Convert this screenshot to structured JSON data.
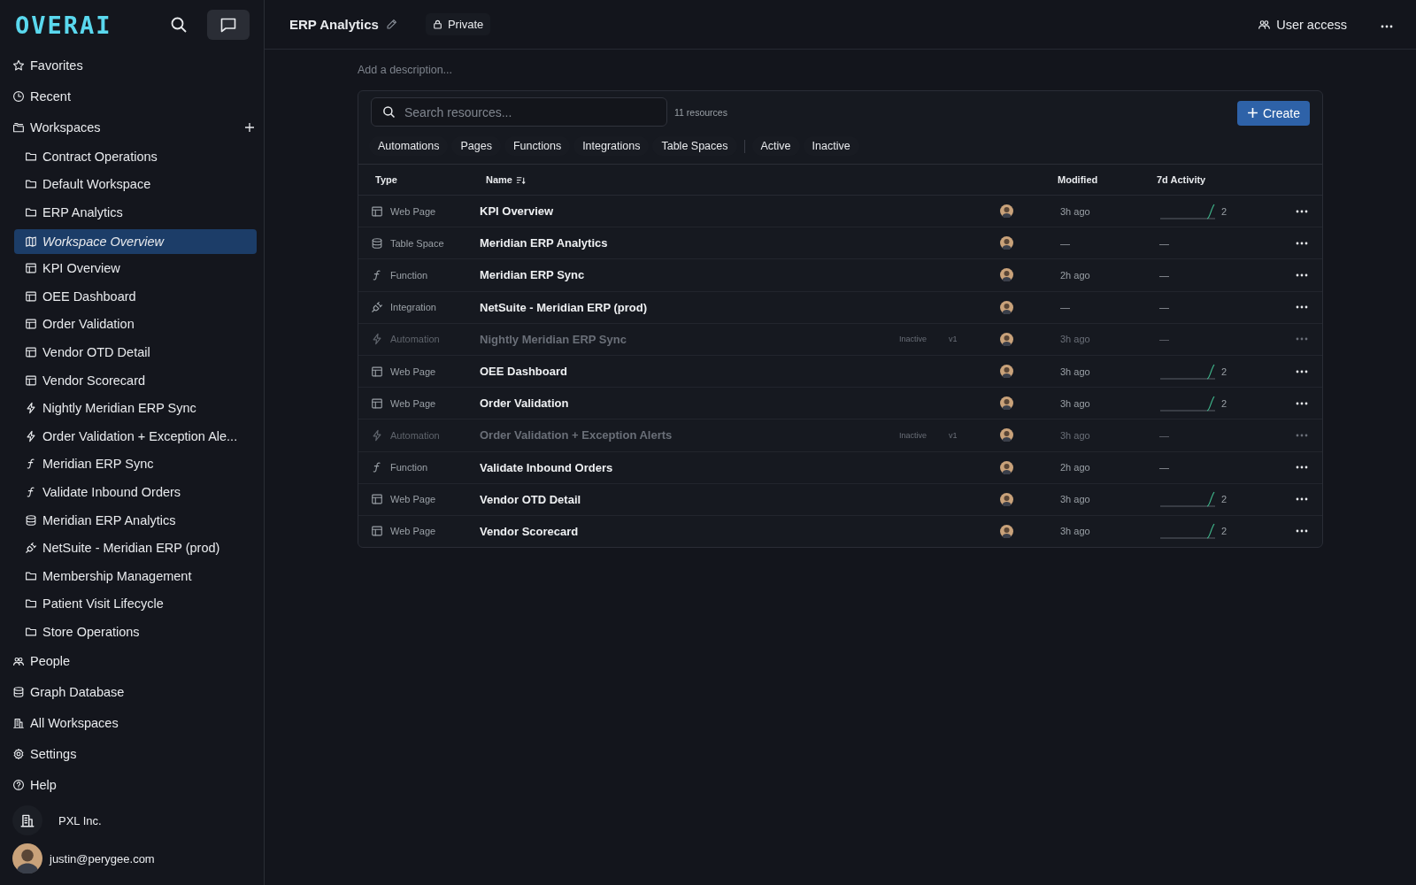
{
  "logo": "OVERAI",
  "sidebar": {
    "items": [
      {
        "kind": "star",
        "label": "Favorites",
        "selected": false
      },
      {
        "kind": "clock",
        "label": "Recent",
        "selected": false
      },
      {
        "kind": "folders",
        "label": "Workspaces",
        "selected": false,
        "addable": true,
        "children": [
          {
            "kind": "folder",
            "label": "Contract Operations",
            "selected": false
          },
          {
            "kind": "folder",
            "label": "Default Workspace",
            "selected": false
          },
          {
            "kind": "folder",
            "label": "ERP Analytics",
            "selected": false,
            "children": [
              {
                "kind": "map",
                "label": "Workspace Overview",
                "selected": true
              },
              {
                "kind": "page",
                "label": "KPI Overview",
                "selected": false
              },
              {
                "kind": "page",
                "label": "OEE Dashboard",
                "selected": false
              },
              {
                "kind": "page",
                "label": "Order Validation",
                "selected": false
              },
              {
                "kind": "page",
                "label": "Vendor OTD Detail",
                "selected": false
              },
              {
                "kind": "page",
                "label": "Vendor Scorecard",
                "selected": false
              },
              {
                "kind": "automation",
                "label": "Nightly Meridian ERP Sync",
                "selected": false
              },
              {
                "kind": "automation",
                "label": "Order Validation + Exception Ale...",
                "selected": false
              },
              {
                "kind": "function",
                "label": "Meridian ERP Sync",
                "selected": false
              },
              {
                "kind": "function",
                "label": "Validate Inbound Orders",
                "selected": false
              },
              {
                "kind": "tablespace",
                "label": "Meridian ERP Analytics",
                "selected": false
              },
              {
                "kind": "integration",
                "label": "NetSuite - Meridian ERP (prod)",
                "selected": false
              }
            ]
          },
          {
            "kind": "folder",
            "label": "Membership Management",
            "selected": false
          },
          {
            "kind": "folder",
            "label": "Patient Visit Lifecycle",
            "selected": false
          },
          {
            "kind": "folder",
            "label": "Store Operations",
            "selected": false
          }
        ]
      },
      {
        "kind": "people",
        "label": "People",
        "selected": false
      },
      {
        "kind": "tablespace",
        "label": "Graph Database",
        "selected": false
      },
      {
        "kind": "building",
        "label": "All Workspaces",
        "selected": false
      },
      {
        "kind": "gear",
        "label": "Settings",
        "selected": false
      },
      {
        "kind": "help",
        "label": "Help",
        "selected": false
      }
    ]
  },
  "org": "PXL Inc.",
  "user": "justin@perygee.com",
  "header": {
    "title": "ERP Analytics",
    "visibility": "Private",
    "user_access": "User access"
  },
  "description": {
    "placeholder": "Add a description..."
  },
  "resources": {
    "search": {
      "placeholder": "Search resources..."
    },
    "count": "11 resources",
    "create": "Create",
    "type_filters": [
      {
        "label": "Automations",
        "selected": false
      },
      {
        "label": "Pages",
        "selected": false
      },
      {
        "label": "Functions",
        "selected": false
      },
      {
        "label": "Integrations",
        "selected": false
      },
      {
        "label": "Table Spaces",
        "selected": false
      }
    ],
    "status_filters": [
      {
        "label": "Active",
        "selected": false
      },
      {
        "label": "Inactive",
        "selected": false
      }
    ],
    "columns": [
      "Type",
      "Name",
      "Modified",
      "7d Activity"
    ],
    "rows": [
      {
        "kind": "page",
        "type": "Web Page",
        "name": "KPI Overview",
        "active": true,
        "modified": "3h ago",
        "sparkline": true,
        "activity": "2"
      },
      {
        "kind": "tablespace",
        "type": "Table Space",
        "name": "Meridian ERP Analytics",
        "active": true,
        "modified": "—",
        "sparkline": false,
        "activity": "—"
      },
      {
        "kind": "function",
        "type": "Function",
        "name": "Meridian ERP Sync",
        "active": true,
        "modified": "2h ago",
        "sparkline": false,
        "activity": "—"
      },
      {
        "kind": "integration",
        "type": "Integration",
        "name": "NetSuite - Meridian ERP (prod)",
        "active": true,
        "modified": "—",
        "sparkline": false,
        "activity": "—"
      },
      {
        "kind": "automation",
        "type": "Automation",
        "name": "Nightly Meridian ERP Sync",
        "active": false,
        "status": "Inactive",
        "version": "v1",
        "modified": "3h ago",
        "sparkline": false,
        "activity": "—"
      },
      {
        "kind": "page",
        "type": "Web Page",
        "name": "OEE Dashboard",
        "active": true,
        "modified": "3h ago",
        "sparkline": true,
        "activity": "2"
      },
      {
        "kind": "page",
        "type": "Web Page",
        "name": "Order Validation",
        "active": true,
        "modified": "3h ago",
        "sparkline": true,
        "activity": "2"
      },
      {
        "kind": "automation",
        "type": "Automation",
        "name": "Order Validation + Exception Alerts",
        "active": false,
        "status": "Inactive",
        "version": "v1",
        "modified": "3h ago",
        "sparkline": false,
        "activity": "—"
      },
      {
        "kind": "function",
        "type": "Function",
        "name": "Validate Inbound Orders",
        "active": true,
        "modified": "2h ago",
        "sparkline": false,
        "activity": "—"
      },
      {
        "kind": "page",
        "type": "Web Page",
        "name": "Vendor OTD Detail",
        "active": true,
        "modified": "3h ago",
        "sparkline": true,
        "activity": "2"
      },
      {
        "kind": "page",
        "type": "Web Page",
        "name": "Vendor Scorecard",
        "active": true,
        "modified": "3h ago",
        "sparkline": true,
        "activity": "2"
      }
    ]
  }
}
